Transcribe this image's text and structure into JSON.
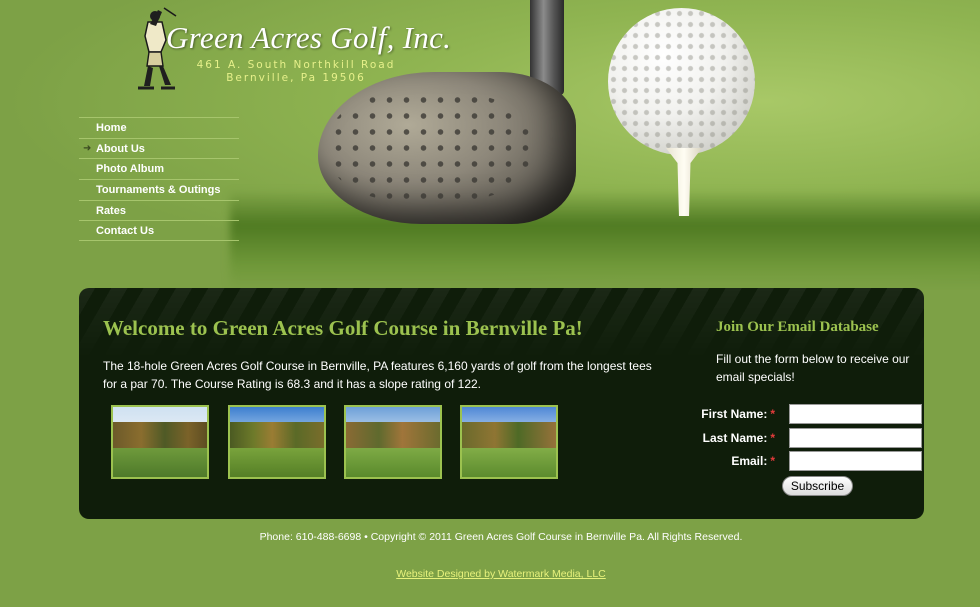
{
  "header": {
    "logo_title": "Green Acres Golf, Inc.",
    "address_line1": "461 A. South Northkill Road",
    "address_line2": "Bernville, Pa 19506"
  },
  "nav": {
    "items": [
      {
        "label": "Home",
        "active": false
      },
      {
        "label": "About Us",
        "active": true
      },
      {
        "label": "Photo Album",
        "active": false
      },
      {
        "label": "Tournaments & Outings",
        "active": false
      },
      {
        "label": "Rates",
        "active": false
      },
      {
        "label": "Contact Us",
        "active": false
      }
    ],
    "active_arrow": "➜"
  },
  "main": {
    "title": "Welcome to Green Acres Golf Course in Bernville Pa!",
    "intro": "The 18-hole Green Acres Golf Course in Bernville, PA features 6,160 yards of golf from the longest tees for a par 70. The Course Rating is 68.3 and it has a slope rating of 122."
  },
  "thumbnails": [
    {
      "name": "course-photo-1"
    },
    {
      "name": "course-photo-2"
    },
    {
      "name": "course-photo-3"
    },
    {
      "name": "course-photo-4"
    }
  ],
  "email_form": {
    "title": "Join Our Email Database",
    "description": "Fill out the form below to receive our email specials!",
    "first_name_label": "First Name:",
    "last_name_label": "Last Name:",
    "email_label": "Email:",
    "required_mark": "*",
    "first_name_value": "",
    "last_name_value": "",
    "email_value": "",
    "submit_label": "Subscribe"
  },
  "footer": {
    "copyright": "Phone: 610-488-6698 • Copyright © 2011 Green Acres Golf Course in Bernville Pa. All Rights Reserved.",
    "credit_link": "Website Designed by Watermark Media, LLC"
  },
  "colors": {
    "page_bg": "#7da146",
    "panel_bg": "#0f1d0a",
    "heading_green": "#9cc24f",
    "link_yellow": "#e7f27c",
    "required_red": "#e23b3b"
  }
}
